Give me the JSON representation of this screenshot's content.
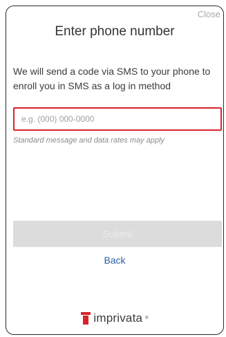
{
  "dialog": {
    "close_label": "Close",
    "title": "Enter phone number",
    "description": "We will send a code via SMS to your phone to enroll you in SMS as a log in method"
  },
  "phone_input": {
    "placeholder": "e.g. (000) 000-0000",
    "value": ""
  },
  "rates_note": "Standard message and data rates may apply",
  "actions": {
    "submit_label": "Submit",
    "submit_enabled": false,
    "back_label": "Back"
  },
  "branding": {
    "logo_text": "imprivata",
    "logo_icon": "imprivata-logo-icon",
    "trademark": "®"
  },
  "colors": {
    "accent_red": "#d6252c",
    "link_blue": "#2a5fa8",
    "disabled_button": "#dcdcdc"
  }
}
